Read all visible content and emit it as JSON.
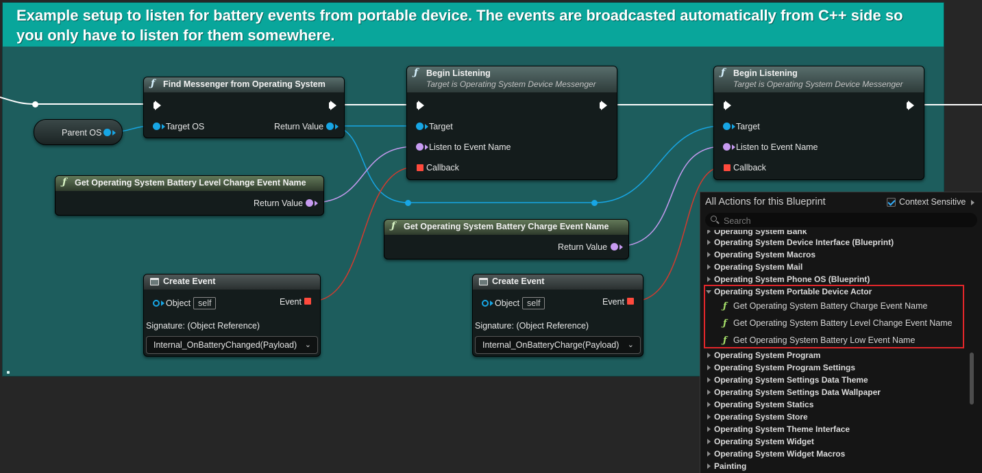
{
  "comment": {
    "text": "Example setup to listen for battery events from portable device. The events are broadcasted automatically from C++ side so you only have to listen for them somewhere."
  },
  "variable": {
    "label": "Parent OS"
  },
  "nodes": {
    "find_messenger": {
      "title": "Find Messenger from Operating System",
      "pin_target": "Target OS",
      "pin_return": "Return Value"
    },
    "begin_listening_1": {
      "title": "Begin Listening",
      "subtitle": "Target is Operating System Device Messenger",
      "pin_target": "Target",
      "pin_event_name": "Listen to Event Name",
      "pin_callback": "Callback"
    },
    "begin_listening_2": {
      "title": "Begin Listening",
      "subtitle": "Target is Operating System Device Messenger",
      "pin_target": "Target",
      "pin_event_name": "Listen to Event Name",
      "pin_callback": "Callback"
    },
    "get_level_change": {
      "title": "Get Operating System Battery Level Change Event Name",
      "pin_return": "Return Value"
    },
    "get_charge": {
      "title": "Get Operating System Battery Charge Event Name",
      "pin_return": "Return Value"
    },
    "create_event_1": {
      "title": "Create Event",
      "pin_object": "Object",
      "self": "self",
      "pin_event": "Event",
      "signature": "Signature: (Object Reference)",
      "function": "Internal_OnBatteryChanged(Payload)"
    },
    "create_event_2": {
      "title": "Create Event",
      "pin_object": "Object",
      "self": "self",
      "pin_event": "Event",
      "signature": "Signature: (Object Reference)",
      "function": "Internal_OnBatteryCharge(Payload)"
    }
  },
  "actions_panel": {
    "title": "All Actions for this Blueprint",
    "context_sensitive_label": "Context Sensitive",
    "context_sensitive": true,
    "search_placeholder": "Search",
    "categories_top": [
      "Operating System Bank",
      "Operating System Device Interface (Blueprint)",
      "Operating System Macros",
      "Operating System Mail",
      "Operating System Phone OS (Blueprint)"
    ],
    "expanded_category": "Operating System Portable Device Actor",
    "expanded_items": [
      "Get Operating System Battery Charge Event Name",
      "Get Operating System Battery Level Change Event Name",
      "Get Operating System Battery Low Event Name"
    ],
    "categories_bottom": [
      "Operating System Program",
      "Operating System Program Settings",
      "Operating System Settings Data Theme",
      "Operating System Settings Data Wallpaper",
      "Operating System Statics",
      "Operating System Store",
      "Operating System Theme Interface",
      "Operating System Widget",
      "Operating System Widget Macros",
      "Painting"
    ]
  },
  "colors": {
    "comment_header": "#09a69b",
    "comment_body": "#1d5d5d",
    "object_pin": "#17a6e5",
    "name_pin": "#c79bf1",
    "delegate_pin": "#ff4a3d",
    "exec_wire": "#ffffff",
    "highlight_box": "#e3262a"
  }
}
